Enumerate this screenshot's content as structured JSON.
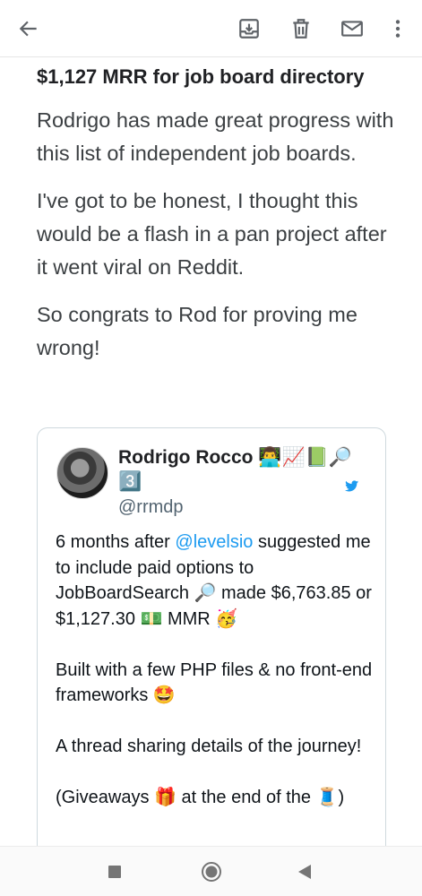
{
  "toolbar": {
    "back": "back-icon",
    "archive": "archive-icon",
    "delete": "delete-icon",
    "mark_unread": "mail-icon",
    "more": "more-vert-icon"
  },
  "email": {
    "headline": "$1,127 MRR for job board directory",
    "paragraphs": [
      "Rodrigo has made great progress with this list of independent job boards.",
      "I've got to be honest, I thought this would be a flash in a pan project after it went viral on Reddit.",
      "So congrats to Rod for proving me wrong!"
    ]
  },
  "tweet": {
    "name": "Rodrigo Rocco",
    "name_emoji": "👨‍💻📈📗🔎3️⃣",
    "handle": "@rrmdp",
    "line1_pre": "6 months after ",
    "mention": "@levelsio",
    "line1_post": " suggested me to include paid options to JobBoardSearch 🔎 made $6,763.85 or $1,127.30 💵 MMR 🥳",
    "para2": "Built with a few PHP files & no front-end frameworks 🤩",
    "para3": "A thread sharing details of the journey!",
    "para4": "(Giveaways 🎁 at the end of the 🧵)"
  },
  "navbar": {
    "recents": "square-icon",
    "home": "home-circle-icon",
    "back": "back-triangle-icon"
  },
  "colors": {
    "link": "#1d9bf0",
    "text": "#202124",
    "icon": "#5f6368"
  }
}
